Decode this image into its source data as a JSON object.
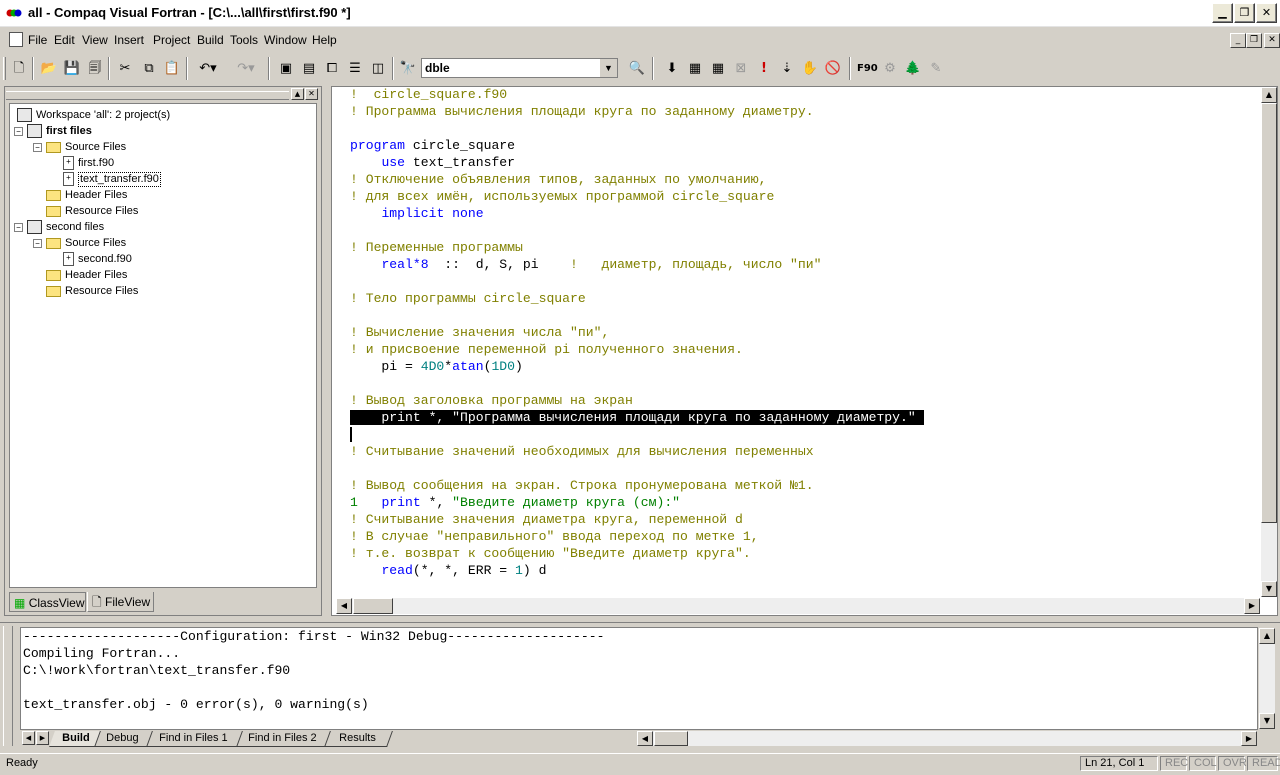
{
  "window": {
    "title": "all - Compaq Visual Fortran - [C:\\...\\all\\first\\first.f90 *]",
    "controls": {
      "minimize": "▁",
      "restore": "❐",
      "close": "✕"
    }
  },
  "menu": {
    "items": [
      "File",
      "Edit",
      "View",
      "Insert",
      "Project",
      "Build",
      "Tools",
      "Window",
      "Help"
    ]
  },
  "toolbar": {
    "find_combo_value": "dble"
  },
  "workspace": {
    "tree": [
      {
        "level": 0,
        "type": "workspace",
        "label": "Workspace 'all': 2 project(s)",
        "bold": false
      },
      {
        "level": 0,
        "type": "project",
        "label": "first files",
        "bold": true,
        "expanded": true
      },
      {
        "level": 1,
        "type": "folder",
        "label": "Source Files",
        "expanded": true
      },
      {
        "level": 2,
        "type": "file",
        "label": "first.f90"
      },
      {
        "level": 2,
        "type": "file",
        "label": "text_transfer.f90",
        "selected": true
      },
      {
        "level": 1,
        "type": "folder",
        "label": "Header Files"
      },
      {
        "level": 1,
        "type": "folder",
        "label": "Resource Files"
      },
      {
        "level": 0,
        "type": "project",
        "label": "second files",
        "bold": false,
        "expanded": true
      },
      {
        "level": 1,
        "type": "folder",
        "label": "Source Files",
        "expanded": true
      },
      {
        "level": 2,
        "type": "file",
        "label": "second.f90"
      },
      {
        "level": 1,
        "type": "folder",
        "label": "Header Files"
      },
      {
        "level": 1,
        "type": "folder",
        "label": "Resource Files"
      }
    ],
    "tabs": [
      "ClassView",
      "FileView"
    ],
    "active_tab": "FileView"
  },
  "editor": {
    "lines": [
      [
        [
          "cm",
          "!  circle_square.f90"
        ]
      ],
      [
        [
          "cm",
          "! Программа вычисления площади круга по заданному диаметру."
        ]
      ],
      [],
      [
        [
          "kw",
          "program"
        ],
        [
          "",
          " circle_square"
        ]
      ],
      [
        [
          "",
          "    "
        ],
        [
          "kw",
          "use"
        ],
        [
          "",
          " text_transfer"
        ]
      ],
      [
        [
          "cm",
          "! Отключение объявления типов, заданных по умолчанию,"
        ]
      ],
      [
        [
          "cm",
          "! для всех имён, используемых программой circle_square"
        ]
      ],
      [
        [
          "",
          "    "
        ],
        [
          "kw",
          "implicit none"
        ]
      ],
      [],
      [
        [
          "cm",
          "! Переменные программы"
        ]
      ],
      [
        [
          "",
          "    "
        ],
        [
          "kw",
          "real*8"
        ],
        [
          "",
          "  ::  d, S, pi    "
        ],
        [
          "cm",
          "!   диаметр, площадь, число \"пи\""
        ]
      ],
      [],
      [
        [
          "cm",
          "! Тело программы circle_square"
        ]
      ],
      [],
      [
        [
          "cm",
          "! Вычисление значения числа \"пи\","
        ]
      ],
      [
        [
          "cm",
          "! и присвоение переменной pi полученного значения."
        ]
      ],
      [
        [
          "",
          "    pi = "
        ],
        [
          "num",
          "4D0"
        ],
        [
          "",
          "*"
        ],
        [
          "kw",
          "atan"
        ],
        [
          "",
          "("
        ],
        [
          "num",
          "1D0"
        ],
        [
          "",
          ")"
        ]
      ],
      [],
      [
        [
          "cm",
          "! Вывод заголовка программы на экран"
        ]
      ],
      [
        [
          "sel",
          "    print *, \"Программа вычисления площади круга по заданному диаметру.\" "
        ]
      ],
      [],
      [
        [
          "cm",
          "! Считывание значений необходимых для вычисления переменных"
        ]
      ],
      [],
      [
        [
          "cm",
          "! Вывод сообщения на экран. Строка пронумерована меткой №1."
        ]
      ],
      [
        [
          "lbl",
          "1"
        ],
        [
          "",
          "   "
        ],
        [
          "kw",
          "print"
        ],
        [
          "",
          " *, "
        ],
        [
          "str",
          "\"Введите диаметр круга (см):\""
        ]
      ],
      [
        [
          "cm",
          "! Считывание значения диаметра круга, переменной d"
        ]
      ],
      [
        [
          "cm",
          "! В случае \"неправильного\" ввода переход по метке 1,"
        ]
      ],
      [
        [
          "cm",
          "! т.е. возврат к сообщению \"Введите диаметр круга\"."
        ]
      ],
      [
        [
          "",
          "    "
        ],
        [
          "kw",
          "read"
        ],
        [
          "",
          "(*, *, ERR = "
        ],
        [
          "num",
          "1"
        ],
        [
          "",
          ") d"
        ]
      ]
    ]
  },
  "output": {
    "lines": [
      "--------------------Configuration: first - Win32 Debug--------------------",
      "Compiling Fortran...",
      "C:\\!work\\fortran\\text_transfer.f90",
      "",
      "text_transfer.obj - 0 error(s), 0 warning(s)"
    ],
    "tabs": [
      "Build",
      "Debug",
      "Find in Files 1",
      "Find in Files 2",
      "Results"
    ],
    "active_tab": "Build"
  },
  "status": {
    "message": "Ready",
    "position": "Ln 21, Col 1",
    "indicators": [
      "REC",
      "COL",
      "OVR",
      "READ"
    ]
  },
  "colors": {
    "comment": "#808000",
    "keyword": "#0000ff",
    "number": "#008080",
    "string": "#008000",
    "chrome": "#d4d0c8"
  }
}
